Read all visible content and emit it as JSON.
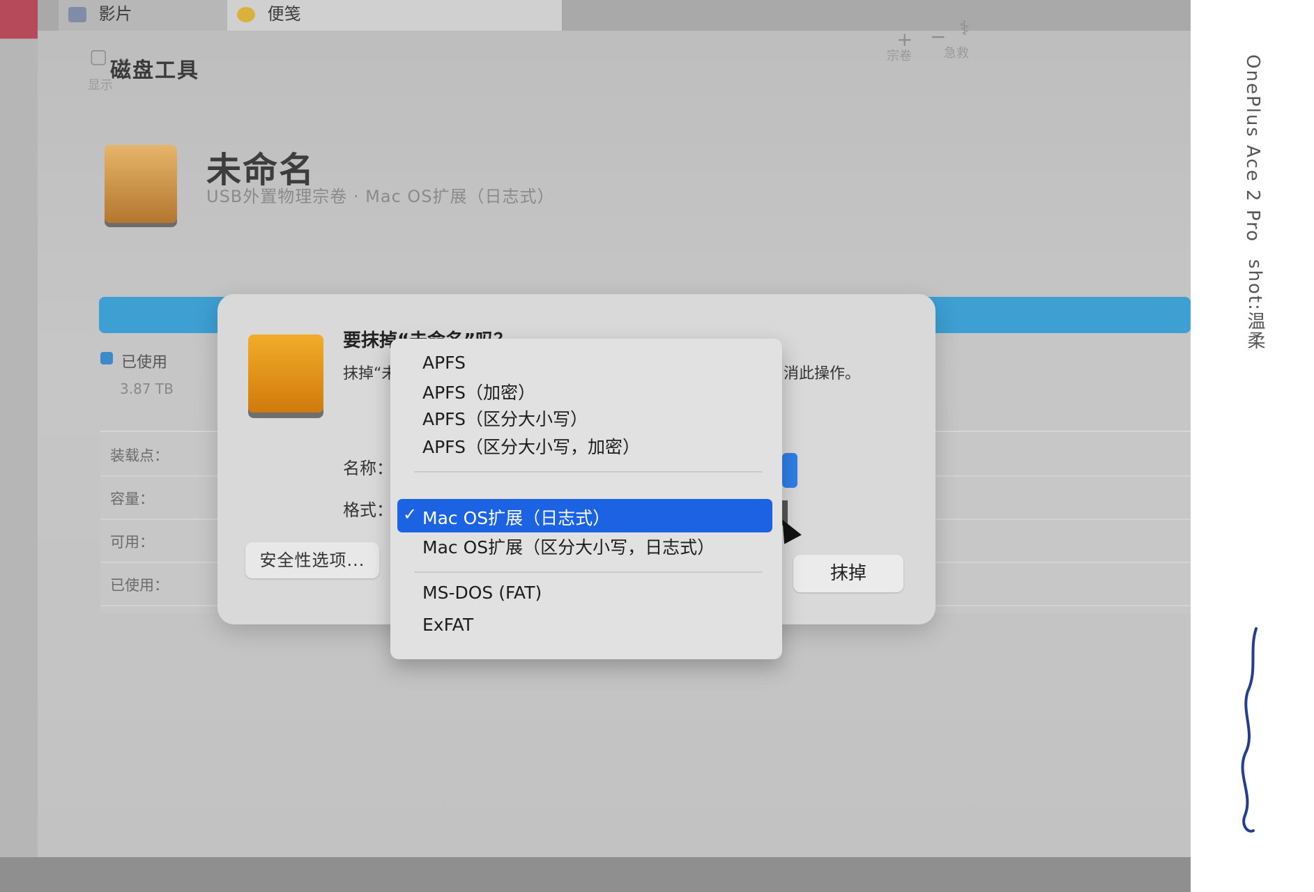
{
  "top_tabs": [
    {
      "label": "影片"
    },
    {
      "label": "便笺"
    }
  ],
  "toolbar": {
    "app_title": "磁盘工具",
    "display_label": "显示",
    "volume_label": "宗卷",
    "info_label": "急救"
  },
  "volume": {
    "name": "未命名",
    "subtitle": "USB外置物理宗卷 · Mac OS扩展（日志式）"
  },
  "usage": {
    "used_label": "已使用",
    "used_value": "3.87 TB",
    "used_color": "#3d89c9"
  },
  "info": {
    "rows": [
      {
        "label": "装载点："
      },
      {
        "label": "容量："
      },
      {
        "label": "可用："
      },
      {
        "label": "已使用："
      }
    ]
  },
  "dialog": {
    "title": "要抹掉“未命名”吗？",
    "message_left": "抹掉“未",
    "message_right": "消此操作。",
    "name_label": "名称：",
    "format_label": "格式：",
    "security_button": "安全性选项...",
    "erase_button": "抹掉"
  },
  "format_menu": {
    "items": [
      {
        "label": "APFS"
      },
      {
        "label": "APFS（加密）"
      },
      {
        "label": "APFS（区分大小写）"
      },
      {
        "label": "APFS（区分大小写，加密）"
      },
      {
        "label": "Mac OS扩展（日志式）",
        "selected": true
      },
      {
        "label": "Mac OS扩展（区分大小写，日志式）"
      },
      {
        "label": "MS-DOS (FAT)"
      },
      {
        "label": "ExFAT"
      }
    ],
    "check_glyph": "✓",
    "selection_color": "#1b63e2"
  },
  "watermark": {
    "device": "OnePlus Ace 2 Pro",
    "shot": "shot:温柔"
  }
}
